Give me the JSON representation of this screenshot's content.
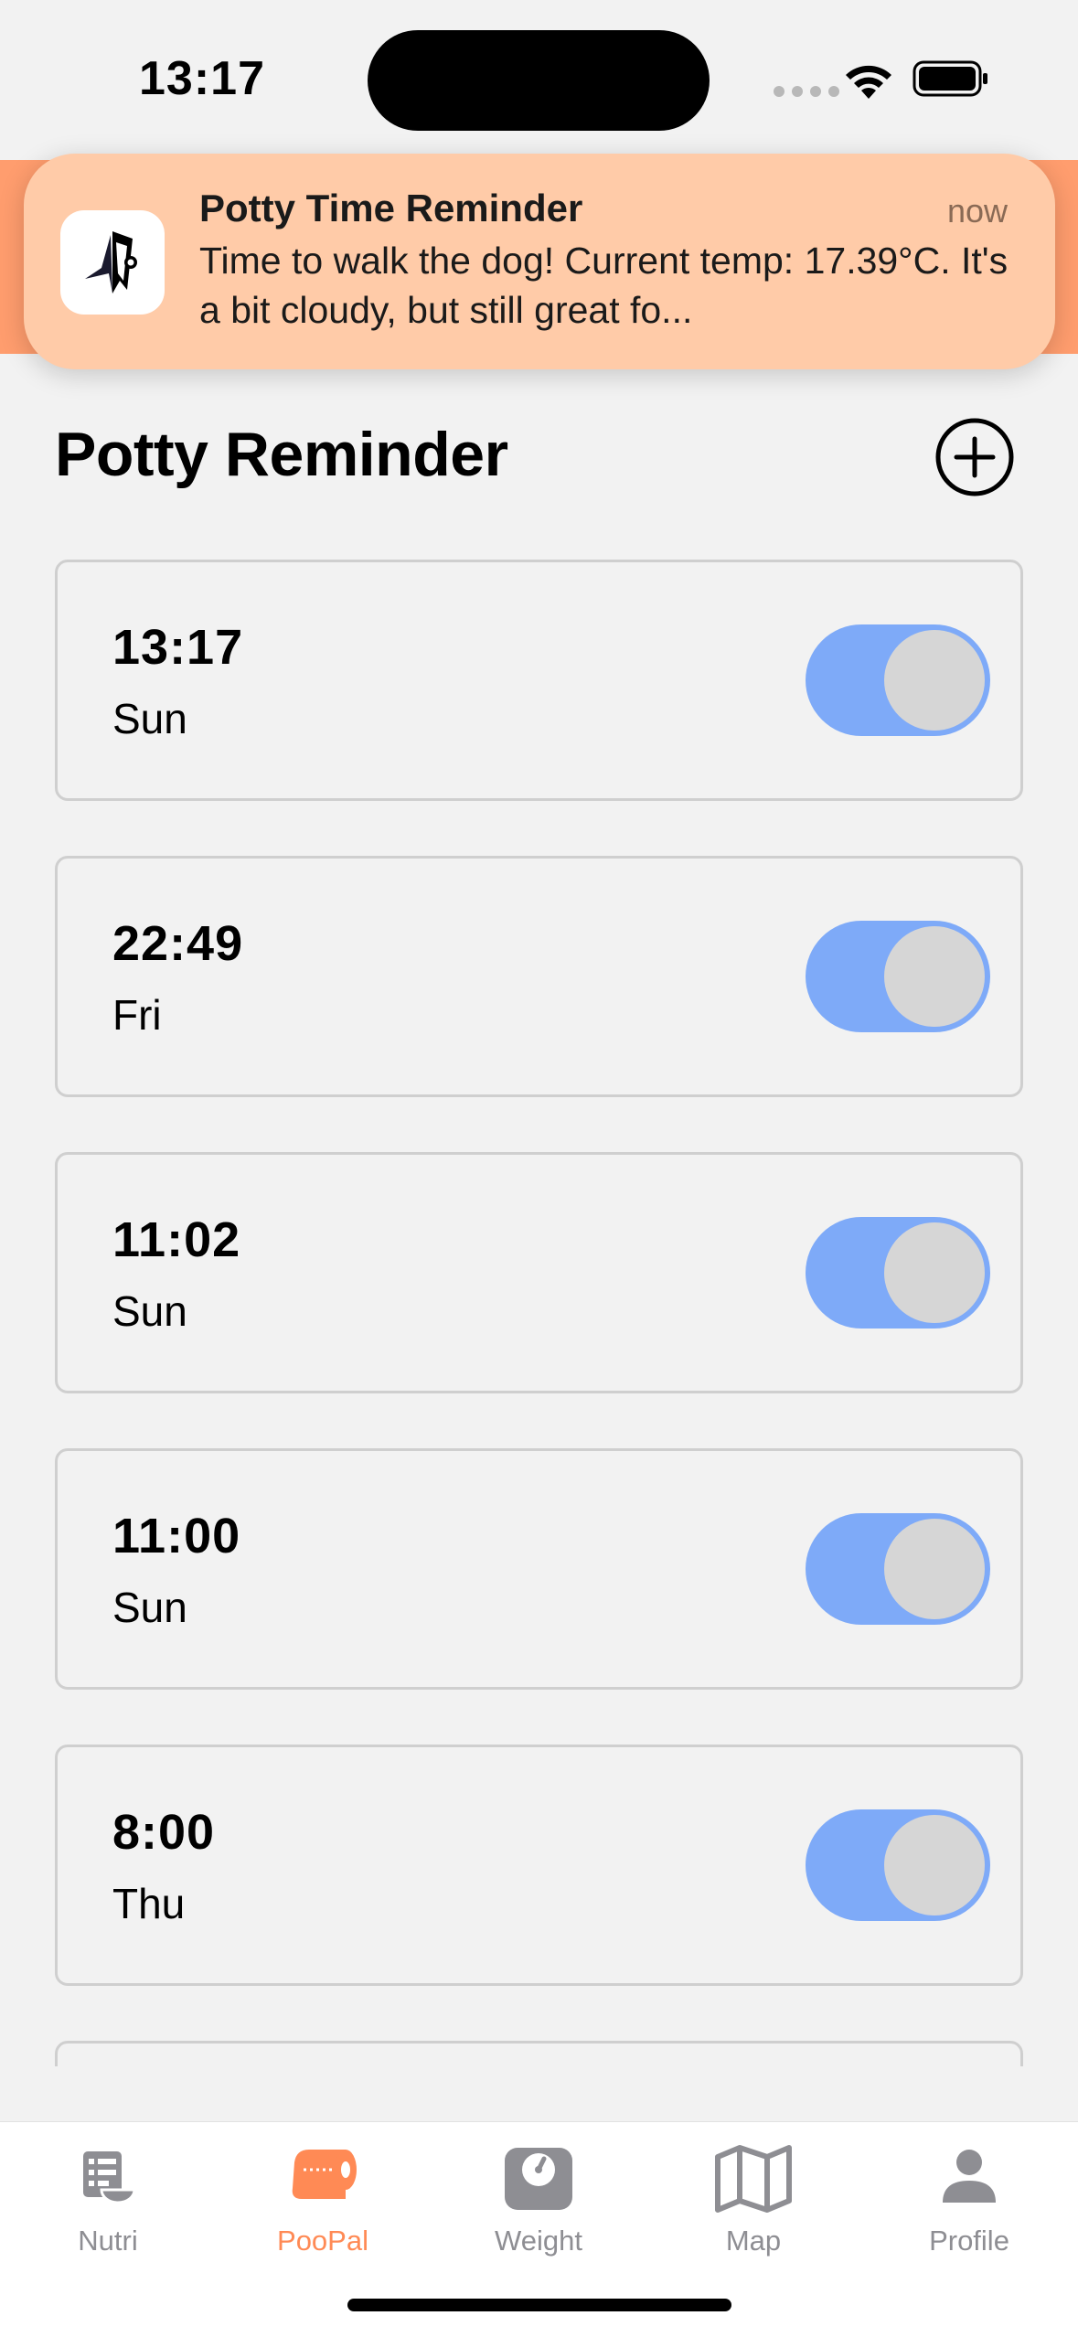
{
  "status_bar": {
    "time": "13:17",
    "icons": [
      "signal-dots-icon",
      "wifi-icon",
      "battery-icon"
    ]
  },
  "notification": {
    "app_icon": "potty-app-icon",
    "title": "Potty Time Reminder",
    "time": "now",
    "body": "Time to walk the dog! Current temp: 17.39°C. It's a bit cloudy, but still great fo..."
  },
  "header": {
    "title": "Potty Reminder",
    "add_icon": "plus-circle-icon"
  },
  "reminders": [
    {
      "time": "13:17",
      "day": "Sun",
      "enabled": true
    },
    {
      "time": "22:49",
      "day": "Fri",
      "enabled": true
    },
    {
      "time": "11:02",
      "day": "Sun",
      "enabled": true
    },
    {
      "time": "11:00",
      "day": "Sun",
      "enabled": true
    },
    {
      "time": "8:00",
      "day": "Thu",
      "enabled": true
    },
    {
      "time": "",
      "day": "",
      "enabled": true
    }
  ],
  "tabs": [
    {
      "label": "Nutri",
      "icon": "nutrition-icon",
      "active": false
    },
    {
      "label": "PooPal",
      "icon": "toilet-roll-icon",
      "active": true
    },
    {
      "label": "Weight",
      "icon": "scale-icon",
      "active": false
    },
    {
      "label": "Map",
      "icon": "map-icon",
      "active": false
    },
    {
      "label": "Profile",
      "icon": "person-icon",
      "active": false
    }
  ],
  "colors": {
    "accent": "#ff8a55",
    "header_strip": "#ff9d6e",
    "notification_bg": "#ffcba8",
    "toggle_on": "#7eaaf8",
    "inactive_tab": "#8e8e93",
    "background": "#f2f2f2"
  }
}
